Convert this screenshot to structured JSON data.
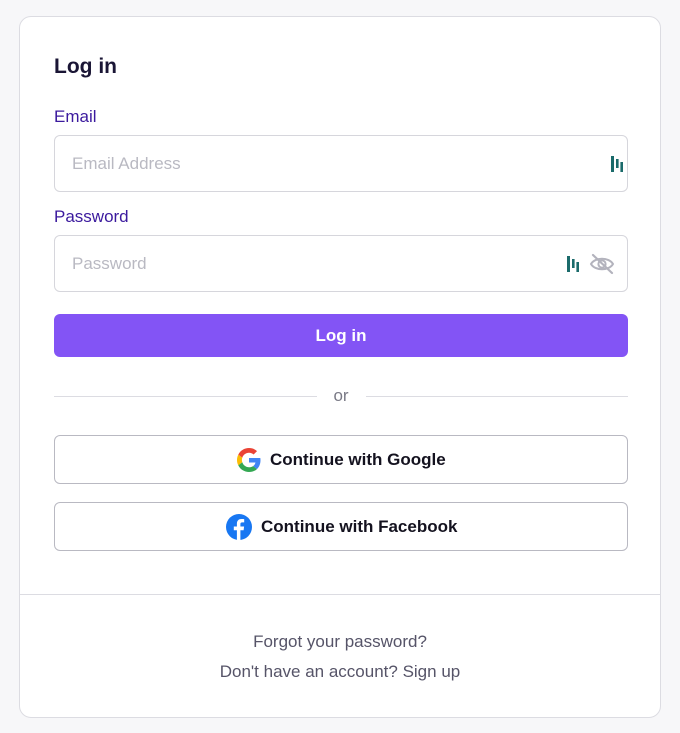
{
  "login_form": {
    "title": "Log in",
    "email": {
      "label": "Email",
      "placeholder": "Email Address",
      "value": ""
    },
    "password": {
      "label": "Password",
      "placeholder": "Password",
      "value": "",
      "visibility_icon": "eye-slash-icon"
    },
    "password_manager_icon": "password-manager-icon",
    "submit_label": "Log in",
    "divider_text": "or",
    "social": [
      {
        "label": "Continue with Google",
        "icon": "google-icon"
      },
      {
        "label": "Continue with Facebook",
        "icon": "facebook-icon"
      }
    ]
  },
  "footer": {
    "forgot_password": "Forgot your password?",
    "signup": "Don't have an account? Sign up"
  },
  "colors": {
    "accent": "#8354f5",
    "label": "#3b1a9e",
    "password_manager": "#1b6b6b",
    "facebook": "#1877f2"
  }
}
